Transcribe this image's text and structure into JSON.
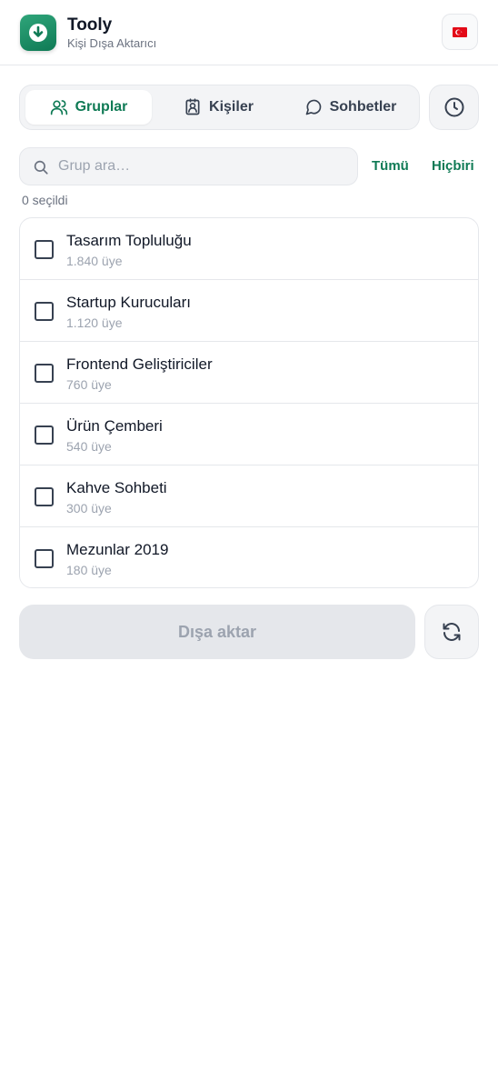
{
  "header": {
    "app_title": "Tooly",
    "app_subtitle": "Kişi Dışa Aktarıcı",
    "app_icon": "download-icon",
    "language_flag": "turkey-flag-icon"
  },
  "tabs": [
    {
      "label": "Gruplar",
      "icon": "users-icon",
      "active": true
    },
    {
      "label": "Kişiler",
      "icon": "contact-card-icon",
      "active": false
    },
    {
      "label": "Sohbetler",
      "icon": "chat-bubble-icon",
      "active": false
    }
  ],
  "history_icon": "clock-icon",
  "search": {
    "placeholder": "Grup ara…",
    "value": ""
  },
  "select_all_label": "Tümü",
  "select_none_label": "Hiçbiri",
  "selected_count_label": "0 seçildi",
  "groups": [
    {
      "name": "Tasarım Topluluğu",
      "members": "1.840 üye",
      "checked": false
    },
    {
      "name": "Startup Kurucuları",
      "members": "1.120 üye",
      "checked": false
    },
    {
      "name": "Frontend Geliştiriciler",
      "members": "760 üye",
      "checked": false
    },
    {
      "name": "Ürün Çemberi",
      "members": "540 üye",
      "checked": false
    },
    {
      "name": "Kahve Sohbeti",
      "members": "300 üye",
      "checked": false
    },
    {
      "name": "Mezunlar 2019",
      "members": "180 üye",
      "checked": false
    }
  ],
  "export_label": "Dışa aktar",
  "refresh_icon": "refresh-icon",
  "colors": {
    "accent": "#0f7a55",
    "disabled_bg": "#e5e7eb",
    "disabled_text": "#9ca3af"
  }
}
